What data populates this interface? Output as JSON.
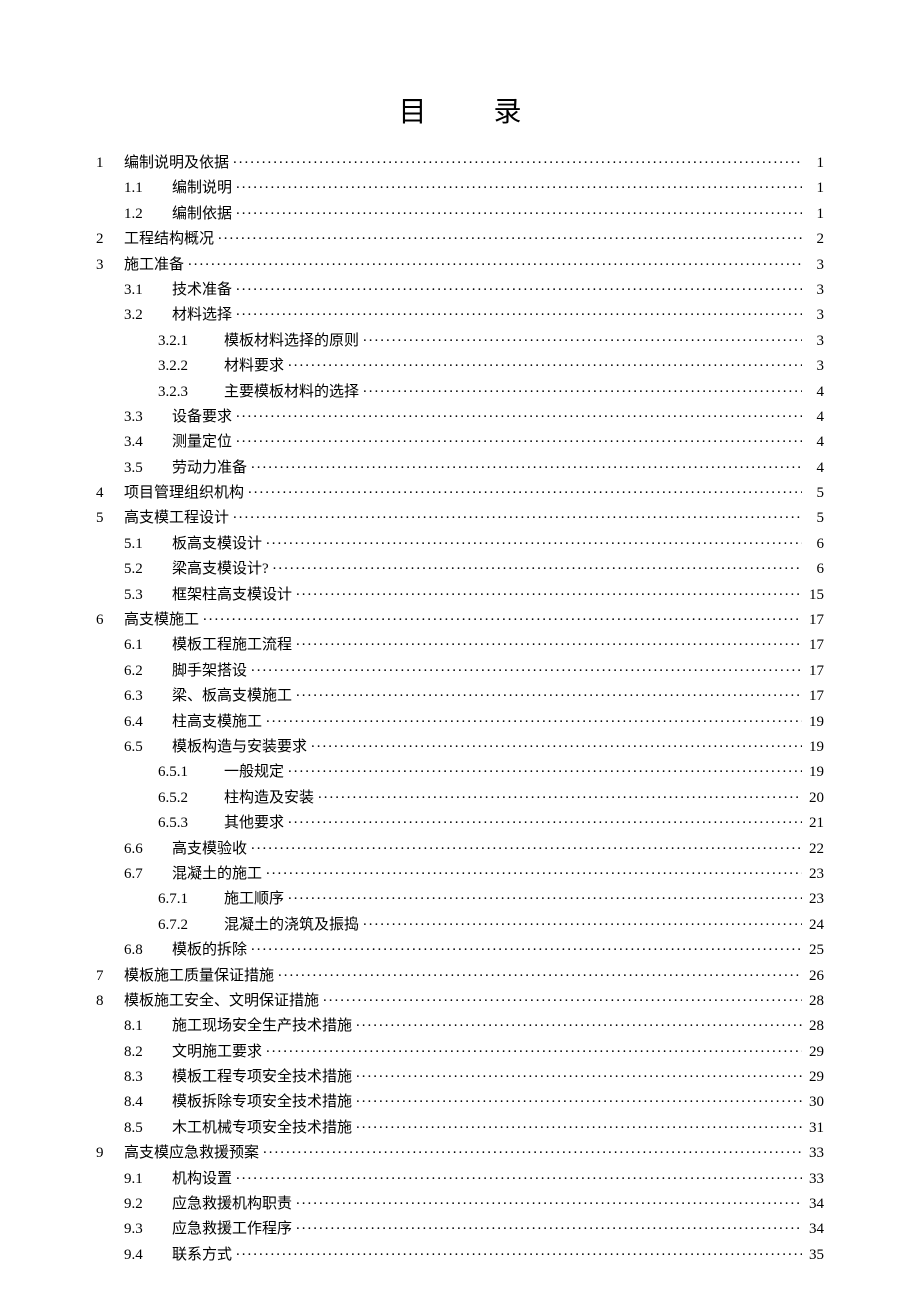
{
  "title": "目 录",
  "toc": [
    {
      "level": 1,
      "chapter": "1",
      "num": "",
      "label": "编制说明及依据",
      "page": "1"
    },
    {
      "level": 2,
      "chapter": "",
      "num": "1.1",
      "label": "编制说明",
      "page": "1"
    },
    {
      "level": 2,
      "chapter": "",
      "num": "1.2",
      "label": "编制依据",
      "page": "1"
    },
    {
      "level": 1,
      "chapter": "2",
      "num": "",
      "label": "工程结构概况",
      "page": "2"
    },
    {
      "level": 1,
      "chapter": "3",
      "num": "",
      "label": "施工准备",
      "page": "3"
    },
    {
      "level": 2,
      "chapter": "",
      "num": "3.1",
      "label": "技术准备",
      "page": "3"
    },
    {
      "level": 2,
      "chapter": "",
      "num": "3.2",
      "label": "材料选择",
      "page": "3"
    },
    {
      "level": 3,
      "chapter": "",
      "num": "3.2.1",
      "label": "模板材料选择的原则",
      "page": "3"
    },
    {
      "level": 3,
      "chapter": "",
      "num": "3.2.2",
      "label": "材料要求",
      "page": "3"
    },
    {
      "level": 3,
      "chapter": "",
      "num": "3.2.3",
      "label": "主要模板材料的选择",
      "page": "4"
    },
    {
      "level": 2,
      "chapter": "",
      "num": "3.3",
      "label": "设备要求",
      "page": "4"
    },
    {
      "level": 2,
      "chapter": "",
      "num": "3.4",
      "label": "测量定位",
      "page": "4"
    },
    {
      "level": 2,
      "chapter": "",
      "num": "3.5",
      "label": "劳动力准备",
      "page": "4"
    },
    {
      "level": 1,
      "chapter": "4",
      "num": "",
      "label": "项目管理组织机构",
      "page": "5"
    },
    {
      "level": 1,
      "chapter": "5",
      "num": "",
      "label": "高支模工程设计",
      "page": "5"
    },
    {
      "level": 2,
      "chapter": "",
      "num": "5.1",
      "label": "板高支模设计",
      "page": "6"
    },
    {
      "level": 2,
      "chapter": "",
      "num": "5.2",
      "label": "梁高支模设计?",
      "page": "6"
    },
    {
      "level": 2,
      "chapter": "",
      "num": "5.3",
      "label": "框架柱高支模设计",
      "page": "15"
    },
    {
      "level": 1,
      "chapter": "6",
      "num": "",
      "label": "高支模施工",
      "page": "17"
    },
    {
      "level": 2,
      "chapter": "",
      "num": "6.1",
      "label": "模板工程施工流程",
      "page": "17"
    },
    {
      "level": 2,
      "chapter": "",
      "num": "6.2",
      "label": "脚手架搭设",
      "page": "17"
    },
    {
      "level": 2,
      "chapter": "",
      "num": "6.3",
      "label": "梁、板高支模施工",
      "page": "17"
    },
    {
      "level": 2,
      "chapter": "",
      "num": "6.4",
      "label": "柱高支模施工",
      "page": "19"
    },
    {
      "level": 2,
      "chapter": "",
      "num": "6.5",
      "label": "模板构造与安装要求",
      "page": "19"
    },
    {
      "level": 3,
      "chapter": "",
      "num": "6.5.1",
      "label": "一般规定",
      "page": "19"
    },
    {
      "level": 3,
      "chapter": "",
      "num": "6.5.2",
      "label": "柱构造及安装",
      "page": "20"
    },
    {
      "level": 3,
      "chapter": "",
      "num": "6.5.3",
      "label": "其他要求",
      "page": "21"
    },
    {
      "level": 2,
      "chapter": "",
      "num": "6.6",
      "label": "高支模验收",
      "page": "22"
    },
    {
      "level": 2,
      "chapter": "",
      "num": "6.7",
      "label": "混凝土的施工",
      "page": "23"
    },
    {
      "level": 3,
      "chapter": "",
      "num": "6.7.1",
      "label": "施工顺序",
      "page": "23"
    },
    {
      "level": 3,
      "chapter": "",
      "num": "6.7.2",
      "label": "混凝土的浇筑及振捣",
      "page": "24"
    },
    {
      "level": 2,
      "chapter": "",
      "num": "6.8",
      "label": "模板的拆除",
      "page": "25"
    },
    {
      "level": 1,
      "chapter": "7",
      "num": "",
      "label": "模板施工质量保证措施",
      "page": "26"
    },
    {
      "level": 1,
      "chapter": "8",
      "num": "",
      "label": "模板施工安全、文明保证措施",
      "page": "28"
    },
    {
      "level": 2,
      "chapter": "",
      "num": "8.1",
      "label": "施工现场安全生产技术措施",
      "page": "28"
    },
    {
      "level": 2,
      "chapter": "",
      "num": "8.2",
      "label": "文明施工要求",
      "page": "29"
    },
    {
      "level": 2,
      "chapter": "",
      "num": "8.3",
      "label": "模板工程专项安全技术措施",
      "page": "29"
    },
    {
      "level": 2,
      "chapter": "",
      "num": "8.4",
      "label": "模板拆除专项安全技术措施",
      "page": "30"
    },
    {
      "level": 2,
      "chapter": "",
      "num": "8.5",
      "label": "木工机械专项安全技术措施",
      "page": "31"
    },
    {
      "level": 1,
      "chapter": "9",
      "num": "",
      "label": "高支模应急救援预案",
      "page": "33"
    },
    {
      "level": 2,
      "chapter": "",
      "num": "9.1",
      "label": "机构设置",
      "page": "33"
    },
    {
      "level": 2,
      "chapter": "",
      "num": "9.2",
      "label": "应急救援机构职责",
      "page": "34"
    },
    {
      "level": 2,
      "chapter": "",
      "num": "9.3",
      "label": "应急救援工作程序",
      "page": "34"
    },
    {
      "level": 2,
      "chapter": "",
      "num": "9.4",
      "label": "联系方式",
      "page": "35"
    }
  ]
}
